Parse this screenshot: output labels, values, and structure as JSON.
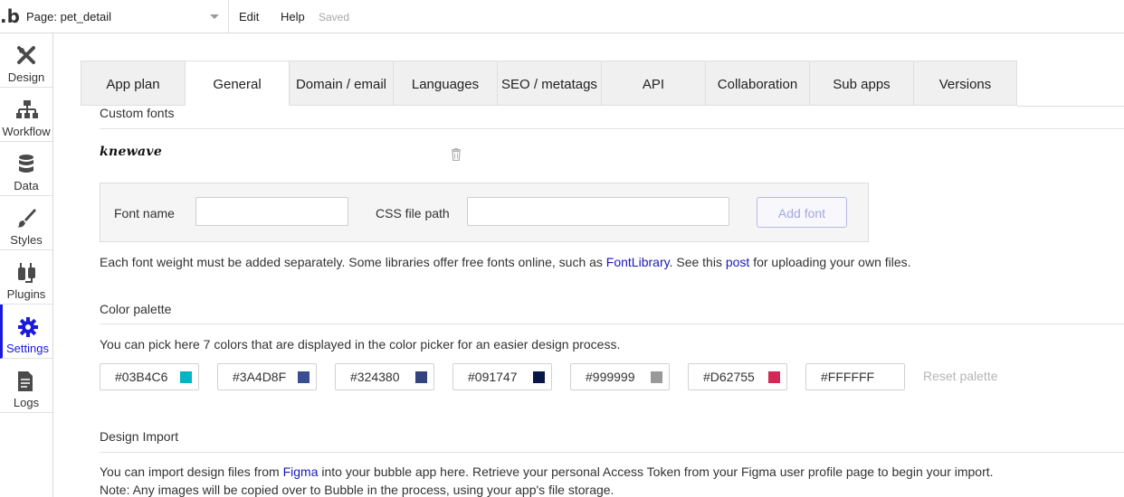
{
  "topbar": {
    "logo": ".b",
    "page_label": "Page: pet_detail",
    "menu_edit": "Edit",
    "menu_help": "Help",
    "status": "Saved"
  },
  "sidebar": {
    "items": [
      {
        "label": "Design",
        "icon": "design-icon"
      },
      {
        "label": "Workflow",
        "icon": "workflow-icon"
      },
      {
        "label": "Data",
        "icon": "database-icon"
      },
      {
        "label": "Styles",
        "icon": "brush-icon"
      },
      {
        "label": "Plugins",
        "icon": "plug-icon"
      },
      {
        "label": "Settings",
        "icon": "gear-icon",
        "active": true
      },
      {
        "label": "Logs",
        "icon": "document-icon"
      }
    ],
    "accent_color": "#1a1adb"
  },
  "tabs": [
    "App plan",
    "General",
    "Domain / email",
    "Languages",
    "SEO / metatags",
    "API",
    "Collaboration",
    "Sub apps",
    "Versions"
  ],
  "active_tab": "General",
  "custom_fonts": {
    "title": "Custom fonts",
    "fonts": [
      "knewave"
    ],
    "font_name_label": "Font name",
    "font_name_value": "",
    "css_path_label": "CSS file path",
    "css_path_value": "",
    "add_button": "Add font",
    "note_before": "Each font weight must be added separately. Some libraries offer free fonts online, such as ",
    "note_link1": "FontLibrary",
    "note_middle": ". See this ",
    "note_link2": "post",
    "note_after": " for uploading your own files."
  },
  "color_palette": {
    "title": "Color palette",
    "description": "You can pick here 7 colors that are displayed in the color picker for an easier design process.",
    "colors": [
      "#03B4C6",
      "#3A4D8F",
      "#324380",
      "#091747",
      "#999999",
      "#D62755",
      "#FFFFFF"
    ],
    "reset_label": "Reset palette"
  },
  "design_import": {
    "title": "Design Import",
    "line1_before": "You can import design files from ",
    "line1_link": "Figma",
    "line1_after": " into your bubble app here. Retrieve your personal Access Token from your Figma user profile page to begin your import.",
    "line2": "Note: Any images will be copied over to Bubble in the process, using your app's file storage."
  }
}
